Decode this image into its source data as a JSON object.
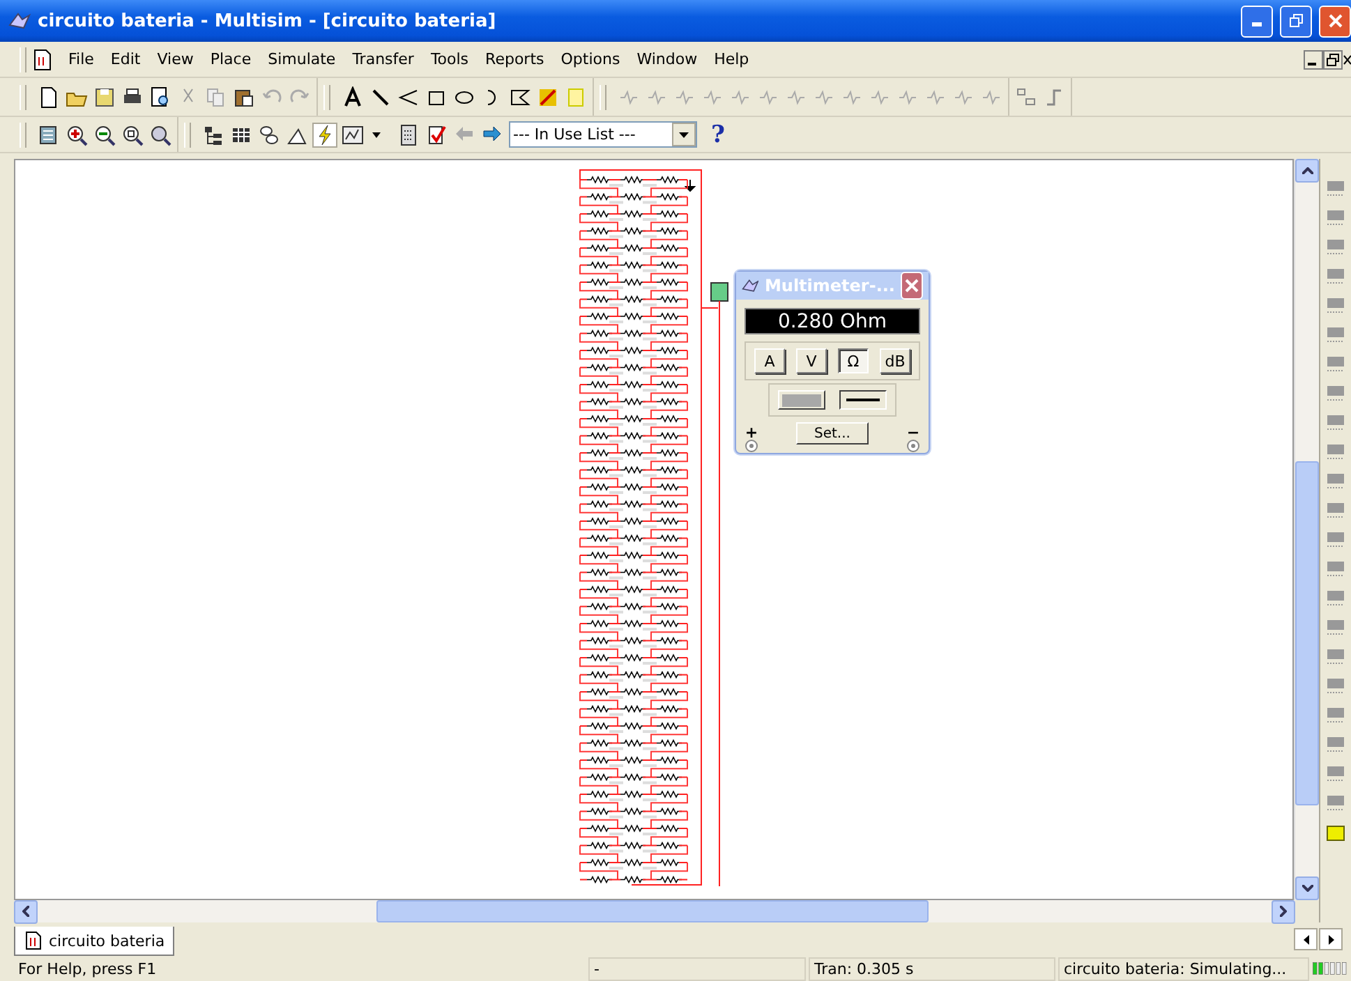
{
  "window": {
    "title": "circuito bateria - Multisim - [circuito bateria]"
  },
  "menu": [
    "File",
    "Edit",
    "View",
    "Place",
    "Simulate",
    "Transfer",
    "Tools",
    "Reports",
    "Options",
    "Window",
    "Help"
  ],
  "toolbar": {
    "in_use_list": "--- In Use List ---",
    "help": "?"
  },
  "multimeter": {
    "title": "Multimeter-...",
    "reading": "0.280 Ohm",
    "modes": [
      {
        "label": "A",
        "selected": false
      },
      {
        "label": "V",
        "selected": false
      },
      {
        "label": "Ω",
        "selected": true
      },
      {
        "label": "dB",
        "selected": false
      }
    ],
    "signal": [
      {
        "kind": "ac",
        "selected": false
      },
      {
        "kind": "dc",
        "selected": true
      }
    ],
    "plus": "+",
    "minus": "−",
    "set_button": "Set..."
  },
  "tabs": [
    {
      "label": "circuito bateria",
      "selected": true
    }
  ],
  "status_bar": [
    "For Help, press F1",
    "-",
    "Tran: 0.305 s",
    "circuito bateria: Simulating..."
  ]
}
